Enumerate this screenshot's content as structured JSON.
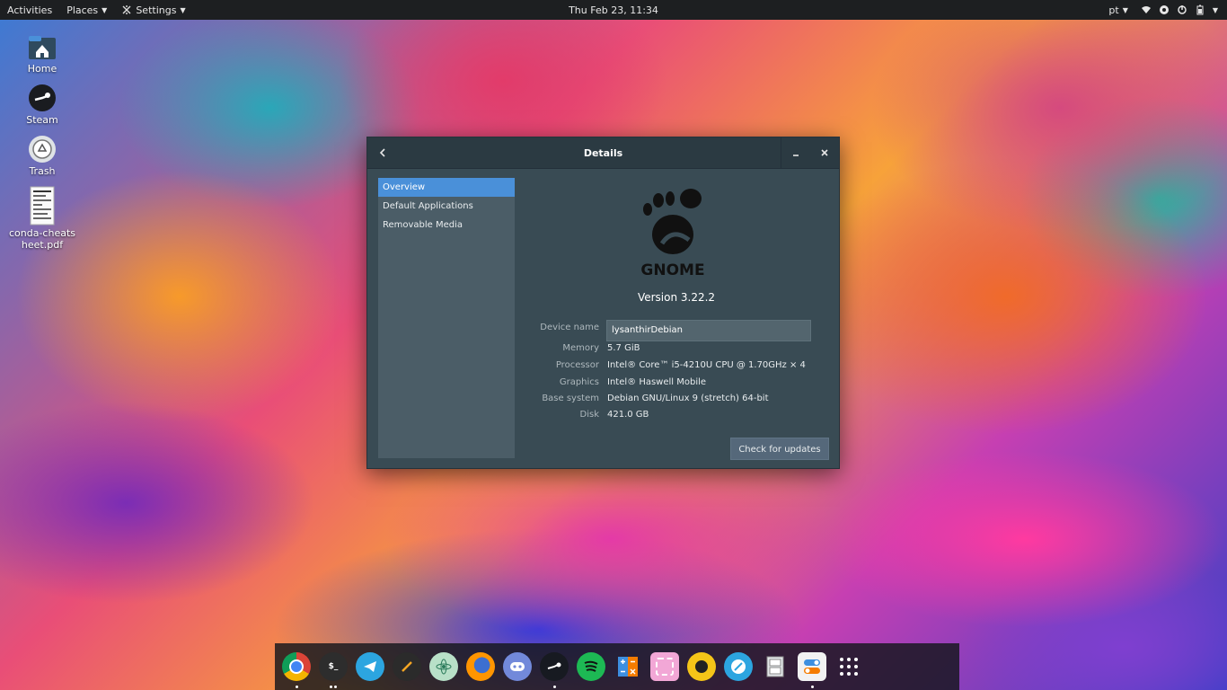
{
  "topbar": {
    "activities": "Activities",
    "places": "Places",
    "settings": "Settings",
    "clock": "Thu Feb 23, 11:34",
    "language": "pt"
  },
  "desktop": {
    "icons": [
      {
        "label": "Home",
        "icon": "home-folder-icon"
      },
      {
        "label": "Steam",
        "icon": "steam-icon"
      },
      {
        "label": "Trash",
        "icon": "trash-icon"
      },
      {
        "label": "conda-cheatsheet.pdf",
        "icon": "pdf-document-icon"
      }
    ]
  },
  "window": {
    "title": "Details",
    "sidebar": [
      "Overview",
      "Default Applications",
      "Removable Media"
    ],
    "active_sidebar": "Overview",
    "logo_text": "GNOME",
    "version": "Version 3.22.2",
    "device_name_label": "Device name",
    "device_name_value": "lysanthirDebian",
    "memory_label": "Memory",
    "memory_value": "5.7 GiB",
    "processor_label": "Processor",
    "processor_value": "Intel® Core™ i5-4210U CPU @ 1.70GHz × 4",
    "graphics_label": "Graphics",
    "graphics_value": "Intel® Haswell Mobile",
    "base_system_label": "Base system",
    "base_system_value": "Debian GNU/Linux 9 (stretch) 64-bit",
    "disk_label": "Disk",
    "disk_value": "421.0 GB",
    "check_updates": "Check for updates"
  },
  "dock": {
    "apps": [
      {
        "name": "chrome-icon",
        "color": "#ffffff"
      },
      {
        "name": "terminal-icon",
        "color": "#2d2d2d",
        "glyph": "$_"
      },
      {
        "name": "telegram-icon",
        "color": "#2ca5e0"
      },
      {
        "name": "text-editor-icon",
        "color": "#2b2b2b"
      },
      {
        "name": "atom-icon",
        "color": "#b8e0c8"
      },
      {
        "name": "firefox-icon",
        "color": "#e66000"
      },
      {
        "name": "discord-icon",
        "color": "#7289da"
      },
      {
        "name": "steam-icon",
        "color": "#171a21"
      },
      {
        "name": "spotify-icon",
        "color": "#1db954"
      },
      {
        "name": "calculator-icon",
        "color": "#3d8fe0"
      },
      {
        "name": "screenshot-icon",
        "color": "#f2a7d6"
      },
      {
        "name": "music-player-icon",
        "color": "#f5c518"
      },
      {
        "name": "web-browser-icon",
        "color": "#2ca5e0"
      },
      {
        "name": "file-cabinet-icon",
        "color": "#d0d4d8"
      },
      {
        "name": "settings-toggle-icon",
        "color": "#f2f2f2"
      },
      {
        "name": "app-grid-icon",
        "color": "transparent"
      }
    ]
  }
}
